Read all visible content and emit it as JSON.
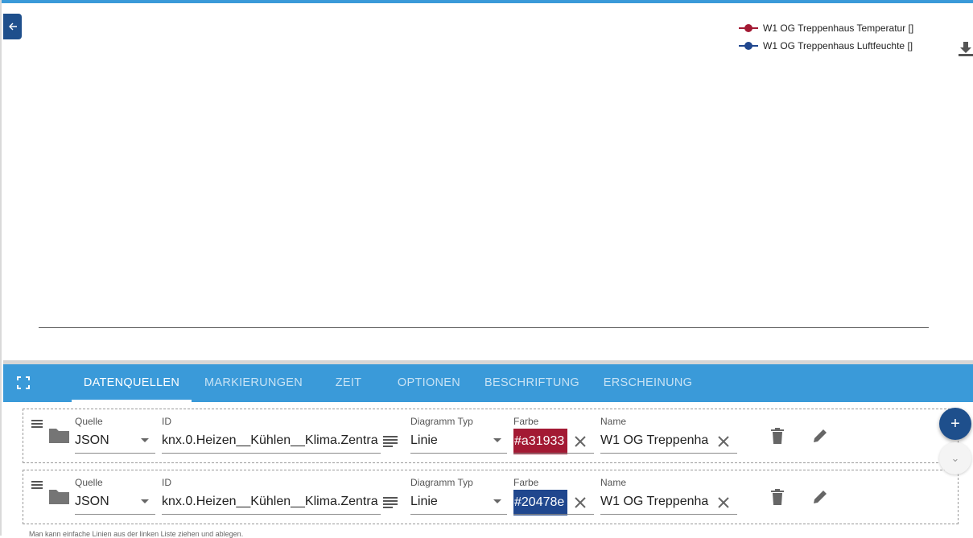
{
  "legend": [
    {
      "label": "W1 OG Treppenhaus Temperatur []",
      "color": "#a31933"
    },
    {
      "label": "W1 OG Treppenhaus Luftfeuchte []",
      "color": "#20478e"
    }
  ],
  "icons": {
    "back": "arrow-left-icon",
    "download": "download-icon",
    "fullscreen": "fullscreen-icon",
    "handle": "drag-handle-icon",
    "folder": "folder-icon",
    "list": "list-icon",
    "clear": "close-icon",
    "delete": "trash-icon",
    "edit": "pencil-icon"
  },
  "tabs": [
    "DATENQUELLEN",
    "MARKIERUNGEN",
    "ZEIT",
    "OPTIONEN",
    "BESCHRIFTUNG",
    "ERSCHEINUNG"
  ],
  "active_tab": 0,
  "labels": {
    "source": "Quelle",
    "id": "ID",
    "chart_type": "Diagramm Typ",
    "color": "Farbe",
    "name": "Name"
  },
  "rows": [
    {
      "source": "JSON",
      "id": "knx.0.Heizen__Kühlen__Klima.Zentra",
      "chart_type": "Linie",
      "color": "#a31933",
      "name": "W1 OG Treppenha"
    },
    {
      "source": "JSON",
      "id": "knx.0.Heizen__Kühlen__Klima.Zentra",
      "chart_type": "Linie",
      "color": "#20478e",
      "name": "W1 OG Treppenha"
    }
  ],
  "fab": {
    "add": "+",
    "scroll": "⌄"
  },
  "hint": "Man kann einfache Linien aus der linken Liste ziehen und ablegen."
}
